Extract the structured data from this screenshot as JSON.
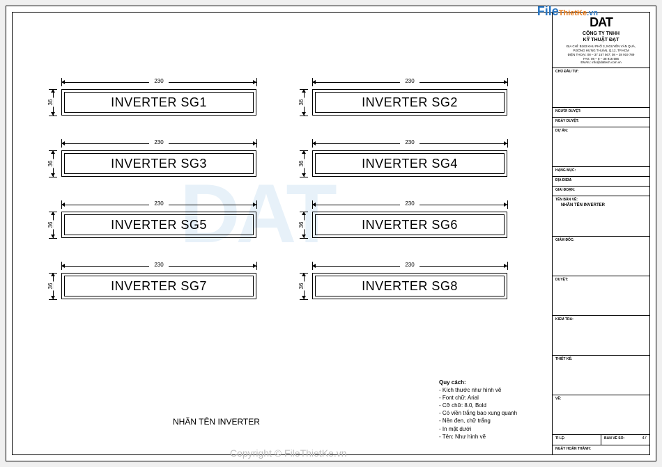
{
  "watermark": {
    "site_a": "File",
    "site_b": "ThietKe",
    "site_c": ".vn",
    "center": "DAT",
    "copyright": "Copyright © FileThietKe.vn"
  },
  "company": {
    "logo_text": "DAT",
    "name_line1": "CÔNG TY TNHH",
    "name_line2": "KỸ THUẬT ĐẠT",
    "address1": "ĐỊA CHỈ: B163 KHU PHỐ 3, NGUYỄN VĂN QUÁ,",
    "address2": "P.ĐÔNG HƯNG THUẬN, Q.12, TP.HCM",
    "phone": "ĐIỆN THOẠI: 08 – 37 157 567; 08 – 38 919 789",
    "fax": "FAX: 08 – 8 – 38 916 586",
    "email": "EMAIL: info@dattech.com.vn"
  },
  "titleblock": {
    "chu_dau_tu": "CHỦ ĐẦU TƯ:",
    "nguoi_duyet": "NGƯỜI DUYỆT:",
    "ngay_duyet": "NGÀY DUYỆT:",
    "du_an": "DỰ ÁN:",
    "hang_muc": "HẠNG MỤC:",
    "dia_diem": "ĐỊA ĐIỂM:",
    "giai_doan": "GIAI ĐOẠN:",
    "ten_ban_ve": "TÊN BẢN VẼ:",
    "ten_ban_ve_value": "NHÃN TÊN INVERTER",
    "giam_doc": "GIÁM ĐỐC:",
    "duyet": "DUYỆT:",
    "kiem_tra": "KIỂM TRA:",
    "thiet_ke": "THIẾT KẾ:",
    "ve": "VẼ:",
    "ti_le": "TỈ LỆ:",
    "ban_ve_so": "BẢN VẼ SỐ:",
    "ban_ve_so_value": "47",
    "ngay_hoan_thanh": "NGÀY HOÀN THÀNH:"
  },
  "dimensions": {
    "width": "230",
    "height": "36"
  },
  "labels": [
    "INVERTER SG1",
    "INVERTER SG2",
    "INVERTER SG3",
    "INVERTER SG4",
    "INVERTER SG5",
    "INVERTER SG6",
    "INVERTER SG7",
    "INVERTER SG8"
  ],
  "sheet_title": "NHÃN TÊN INVERTER",
  "spec": {
    "heading": "Quy cách:",
    "items": [
      "- Kích thước như hình vẽ",
      "- Font chữ: Arial",
      "- Cỡ chữ: 8.0, Bold",
      "- Có viền trắng bao xung quanh",
      "- Nền đen, chữ trắng",
      "- In mặt dưới",
      "- Tên: Như hình vẽ"
    ]
  }
}
